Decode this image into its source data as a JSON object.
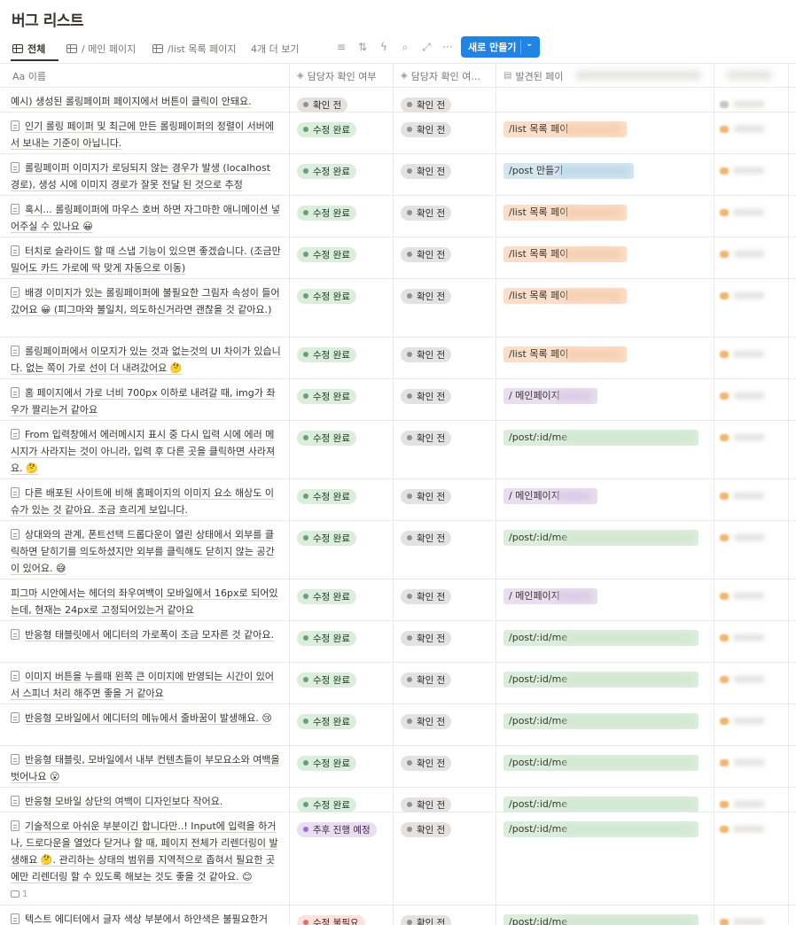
{
  "page": {
    "title": "버그 리스트"
  },
  "views": {
    "tabs": [
      {
        "label": "전체",
        "active": true
      },
      {
        "label": "/ 메인 페이지",
        "active": false
      },
      {
        "label": "/list 목록 페이지",
        "active": false
      }
    ],
    "more_label": "4개 더 보기",
    "new_button_label": "새로 만들기"
  },
  "columns": {
    "name": "Aa 이름",
    "status1": "담당자 확인 여부",
    "status2": "담당자 확인 여...",
    "page": "발견된 페이"
  },
  "status_colors": {
    "green": "#dbeddb",
    "gray": "#e3e2e0",
    "purple": "#e8deee",
    "red": "#ffe2dd",
    "accent": "#2383e2"
  },
  "rows": [
    {
      "doc": false,
      "name": "예시) 생성된 롤링페이퍼 페이지에서 버튼이 클릭이 안돼요.",
      "s1": "확인 전",
      "s1c": "gray",
      "s2": "확인 전",
      "s2c": "gray",
      "page": "",
      "pc": ""
    },
    {
      "doc": true,
      "name": "인기 롤링 페이퍼 및 최근에 만든 롤링페이퍼의 정렬이 서버에서 보내는 기준이 아닙니다.",
      "s1": "수정 완료",
      "s1c": "green",
      "s2": "확인 전",
      "s2c": "gray",
      "page": "/list 목록 페이",
      "pc": "orange"
    },
    {
      "doc": true,
      "name": "롤링페이퍼 이미지가 로딩되지 않는 경우가 발생 (localhost 경로), 생성 시에 이미지 경로가 잘못 전달 된 것으로 추정",
      "s1": "수정 완료",
      "s1c": "green",
      "s2": "확인 전",
      "s2c": "gray",
      "page": "/post 만들기",
      "pc": "blue"
    },
    {
      "doc": true,
      "name": "혹시... 롤링페이퍼에 마우스 호버 하면 자그마한 애니메이션 넣어주실 수 있나요 😀",
      "s1": "수정 완료",
      "s1c": "green",
      "s2": "확인 전",
      "s2c": "gray",
      "page": "/list 목록 페이",
      "pc": "orange"
    },
    {
      "doc": true,
      "name": "터치로 슬라이드 할 때 스냅 기능이 있으면 좋겠습니다. (조금만 밀어도 카드 가로에 딱 맞게 자동으로 이동)",
      "s1": "수정 완료",
      "s1c": "green",
      "s2": "확인 전",
      "s2c": "gray",
      "page": "/list 목록 페이",
      "pc": "orange"
    },
    {
      "doc": true,
      "name": "배경 이미지가 있는 롤링페이퍼에 불필요한 그림자 속성이 들어갔어요 😀 (피그마와 불일치, 의도하신거라면 괜찮을 것 같아요.)",
      "s1": "수정 완료",
      "s1c": "green",
      "s2": "확인 전",
      "s2c": "gray",
      "page": "/list 목록 페이",
      "pc": "orange"
    },
    {
      "doc": true,
      "name": "롤링페이퍼에서 이모지가 있는 것과 없는것의 UI 차이가 있습니다. 없는 쪽이 가로 선이 더 내려갔어요 🤔",
      "s1": "수정 완료",
      "s1c": "green",
      "s2": "확인 전",
      "s2c": "gray",
      "page": "/list 목록 페이",
      "pc": "orange"
    },
    {
      "doc": true,
      "name": "홈 페이지에서 가로 너비 700px 이하로 내려갈 때, img가 좌우가 짤리는거 같아요",
      "s1": "수정 완료",
      "s1c": "green",
      "s2": "확인 전",
      "s2c": "gray",
      "page": "/ 메인페이지",
      "pc": "purple"
    },
    {
      "doc": true,
      "name": "From 입력창에서 에러메시지 표시 중 다시 입력 시에 에러 메시지가 사라지는 것이 아니라, 입력 후 다른 곳을 클릭하면 사라져요. 🤔",
      "s1": "수정 완료",
      "s1c": "green",
      "s2": "확인 전",
      "s2c": "gray",
      "page": "/post/:id/me",
      "pc": "green"
    },
    {
      "doc": true,
      "name": "다른 배포된 사이트에 비해 홈페이지의 이미지 요소 해상도 이슈가 있는 것 같아요. 조금 흐리게 보입니다.",
      "s1": "수정 완료",
      "s1c": "green",
      "s2": "확인 전",
      "s2c": "gray",
      "page": "/ 메인페이지",
      "pc": "purple"
    },
    {
      "doc": true,
      "name": "상대와의 관계, 폰트선택 드롭다운이 열린 상태에서 외부를 클릭하면 닫히기를 의도하셨지만 외부를 클릭해도 닫히지 않는 공간이 있어요. 😅",
      "s1": "수정 완료",
      "s1c": "green",
      "s2": "확인 전",
      "s2c": "gray",
      "page": "/post/:id/me",
      "pc": "green"
    },
    {
      "doc": false,
      "name": "피그마 시안에서는 헤더의 좌우여백이 모바일에서 16px로 되어있는데, 현재는 24px로 고정되어있는거 같아요",
      "s1": "수정 완료",
      "s1c": "green",
      "s2": "확인 전",
      "s2c": "gray",
      "page": "/ 메인페이지",
      "pc": "purple"
    },
    {
      "doc": true,
      "name": "반응형 태블릿에서 에디터의 가로폭이 조금 모자른 것 같아요.",
      "s1": "수정 완료",
      "s1c": "green",
      "s2": "확인 전",
      "s2c": "gray",
      "page": "/post/:id/me",
      "pc": "green"
    },
    {
      "doc": true,
      "name": "이미지 버튼을 누를때 왼쪽 큰 이미지에 반영되는 시간이 있어서 스피너 처리 해주면 좋을 거 같아요",
      "s1": "수정 완료",
      "s1c": "green",
      "s2": "확인 전",
      "s2c": "gray",
      "page": "/post/:id/me",
      "pc": "green"
    },
    {
      "doc": true,
      "name": "반응형 모바일에서 에디터의 메뉴에서 줄바꿈이 발생해요. 😢",
      "s1": "수정 완료",
      "s1c": "green",
      "s2": "확인 전",
      "s2c": "gray",
      "page": "/post/:id/me",
      "pc": "green"
    },
    {
      "doc": true,
      "name": "반응형 태블릿, 모바일에서 내부 컨텐츠들이 부모요소와 여백을 벗어나요 😮",
      "s1": "수정 완료",
      "s1c": "green",
      "s2": "확인 전",
      "s2c": "gray",
      "page": "/post/:id/me",
      "pc": "green"
    },
    {
      "doc": true,
      "name": "반응형 모바일 상단의 여백이 디자인보다 작어요.",
      "s1": "수정 완료",
      "s1c": "green",
      "s2": "확인 전",
      "s2c": "gray",
      "page": "/post/:id/me",
      "pc": "green"
    },
    {
      "doc": true,
      "name": "기술적으로 아쉬운 부분이긴 합니다만..! Input에 입력을 하거나, 드로다운을 열었다 닫거나 할 때, 페이지 전체가 리렌더링이 발생해요 🤔. 관리하는 상태의 범위를 지역적으로 좁혀서 필요한 곳에만 리렌더링 할 수 있도록 해보는 것도 좋을 것 같아요. 😊",
      "comments": "1",
      "s1": "추후 진행 예정",
      "s1c": "purple",
      "s2": "확인 전",
      "s2c": "gray",
      "page": "/post/:id/me",
      "pc": "green"
    },
    {
      "doc": true,
      "name": "텍스트 에디터에서 글자 색상 부분에서 하얀색은 불필요한거",
      "s1": "수정 불필요",
      "s1c": "red",
      "s2": "확인 전",
      "s2c": "gray",
      "page": "/post/:id/me",
      "pc": "green"
    }
  ]
}
